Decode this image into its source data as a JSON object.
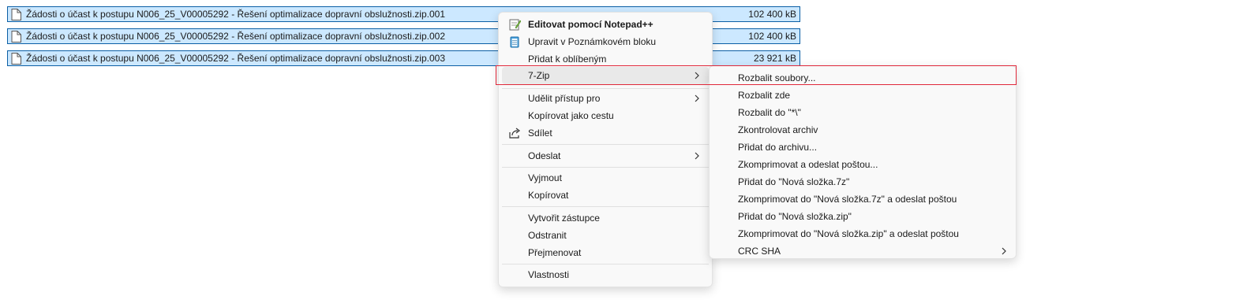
{
  "files": [
    {
      "name": "Žádosti o účast k postupu N006_25_V00005292 - Řešení optimalizace dopravní obslužnosti.zip.001",
      "size": "102 400 kB"
    },
    {
      "name": "Žádosti o účast k postupu N006_25_V00005292 - Řešení optimalizace dopravní obslužnosti.zip.002",
      "size": "102 400 kB"
    },
    {
      "name": "Žádosti o účast k postupu N006_25_V00005292 - Řešení optimalizace dopravní obslužnosti.zip.003",
      "size": "23 921 kB"
    }
  ],
  "context_menu": {
    "items": [
      {
        "label": "Editovat pomocí Notepad++",
        "icon": "notepadpp-icon"
      },
      {
        "label": "Upravit v Poznámkovém bloku",
        "icon": "notepad-icon"
      },
      {
        "label": "Přidat k oblíbeným"
      },
      {
        "label": "7-Zip",
        "submenu": true
      },
      {
        "label": "Udělit přístup pro",
        "submenu": true
      },
      {
        "label": "Kopírovat jako cestu"
      },
      {
        "label": "Sdílet",
        "icon": "share-icon"
      },
      {
        "label": "Odeslat",
        "submenu": true
      },
      {
        "label": "Vyjmout"
      },
      {
        "label": "Kopírovat"
      },
      {
        "label": "Vytvořit zástupce"
      },
      {
        "label": "Odstranit"
      },
      {
        "label": "Přejmenovat"
      },
      {
        "label": "Vlastnosti"
      }
    ]
  },
  "zip_submenu": {
    "items": [
      "Rozbalit soubory...",
      "Rozbalit zde",
      "Rozbalit do \"*\\\"",
      "Zkontrolovat archiv",
      "Přidat do archivu...",
      "Zkomprimovat a odeslat poštou...",
      "Přidat do \"Nová složka.7z\"",
      "Zkomprimovat do \"Nová složka.7z\" a odeslat poštou",
      "Přidat do \"Nová složka.zip\"",
      "Zkomprimovat do \"Nová složka.zip\" a odeslat poštou",
      "CRC SHA"
    ]
  },
  "colors": {
    "selection": "#cce8ff",
    "selection_border": "#0b5fa5",
    "highlight": "#e0283a"
  }
}
